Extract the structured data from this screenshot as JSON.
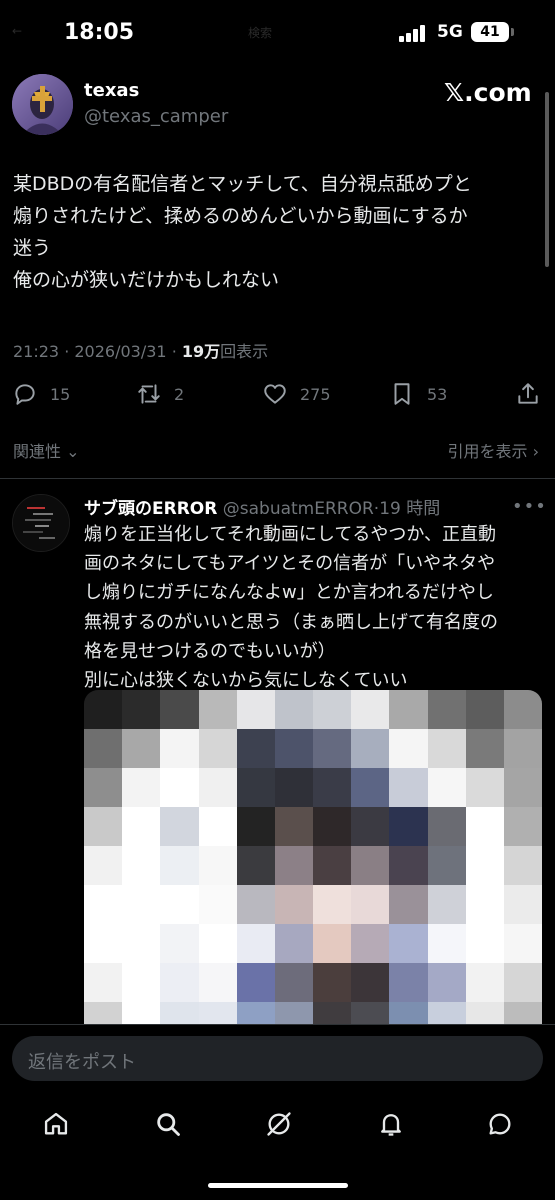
{
  "status_bar": {
    "time": "18:05",
    "network": "5G",
    "battery": "41",
    "faint_left": "←",
    "faint_center": "検索"
  },
  "tweet": {
    "display_name": "texas",
    "handle": "@texas_camper",
    "brand": "𝕏.com",
    "lines": [
      "某DBDの有名配信者とマッチして、自分視点舐めプと",
      "煽りされたけど、揉めるのめんどいから動画にするか",
      "迷う",
      "俺の心が狭いだけかもしれない"
    ],
    "time": "21:23",
    "date": "2026/03/31",
    "views_count": "19万",
    "views_label": "回表示",
    "replies": "15",
    "reposts": "2",
    "likes": "275",
    "bookmarks": "53",
    "related_label": "関連性",
    "quotes_label": "引用を表示"
  },
  "reply": {
    "display_name": "サブ頭のERROR",
    "handle": "@sabuatmERROR",
    "age": "19 時間",
    "lines": [
      "煽りを正当化してそれ動画にしてるやつか、正直動",
      "画のネタにしてもアイツとその信者が「いやネタや",
      "し煽りにガチになんなよw」とか言われるだけやし",
      "無視するのがいいと思う（まぁ晒し上げて有名度の",
      "格を見せつけるのでもいいが）",
      "別に心は狭くないから気にしなくていい"
    ]
  },
  "composer": {
    "placeholder": "返信をポスト"
  },
  "media": {
    "colors": [
      "#1f1f1f",
      "#2b2b2b",
      "#4a4a4a",
      "#b9b9b9",
      "#e6e6e8",
      "#bfc3cb",
      "#cdd0d6",
      "#e9e9ea",
      "#a9a9a9",
      "#717171",
      "#5d5d5d",
      "#8c8c8c",
      "#6f6f6f",
      "#a8a8a8",
      "#f4f4f4",
      "#d6d6d6",
      "#3d4150",
      "#4d536a",
      "#656a80",
      "#a7aebe",
      "#f5f5f5",
      "#d9d9d9",
      "#7a7a7a",
      "#a3a3a3",
      "#8e8e8e",
      "#f3f3f3",
      "#ffffff",
      "#f0f0f0",
      "#353841",
      "#2f3038",
      "#3a3c48",
      "#5c6585",
      "#c8ccd8",
      "#f6f6f6",
      "#dadada",
      "#a5a5a5",
      "#c9c9c9",
      "#ffffff",
      "#d2d6de",
      "#ffffff",
      "#232323",
      "#5a4f4c",
      "#2e2829",
      "#3b3a42",
      "#2c3350",
      "#6a6b72",
      "#ffffff",
      "#b0b0b0",
      "#f1f1f1",
      "#ffffff",
      "#eceff3",
      "#f7f7f7",
      "#3b3b3f",
      "#8c8087",
      "#4a3f42",
      "#8a7f85",
      "#4a4350",
      "#6e727c",
      "#ffffff",
      "#d5d5d5",
      "#ffffff",
      "#ffffff",
      "#ffffff",
      "#fafafa",
      "#b9b8bf",
      "#c8b5b5",
      "#efe0dc",
      "#e8d9d8",
      "#9a9199",
      "#cfd1d8",
      "#ffffff",
      "#ebebeb",
      "#ffffff",
      "#ffffff",
      "#f2f3f6",
      "#ffffff",
      "#e9ebf3",
      "#a7a8c0",
      "#e4c9c0",
      "#b6aab6",
      "#aab2d2",
      "#f5f6fa",
      "#ffffff",
      "#f6f6f6",
      "#f2f2f2",
      "#ffffff",
      "#eceef4",
      "#f6f6f8",
      "#6a72a8",
      "#6d6c7b",
      "#4b3e3d",
      "#3c3539",
      "#7b82a8",
      "#a4a9c6",
      "#f2f2f2",
      "#d6d6d6",
      "#d2d2d2",
      "#ffffff",
      "#dfe4ec",
      "#e2e6ee",
      "#8ea0c4",
      "#8e97ad",
      "#403c3f",
      "#4c4c52",
      "#7c8fb0",
      "#c8cfdd",
      "#e7e7e7",
      "#bcbcbc"
    ]
  }
}
